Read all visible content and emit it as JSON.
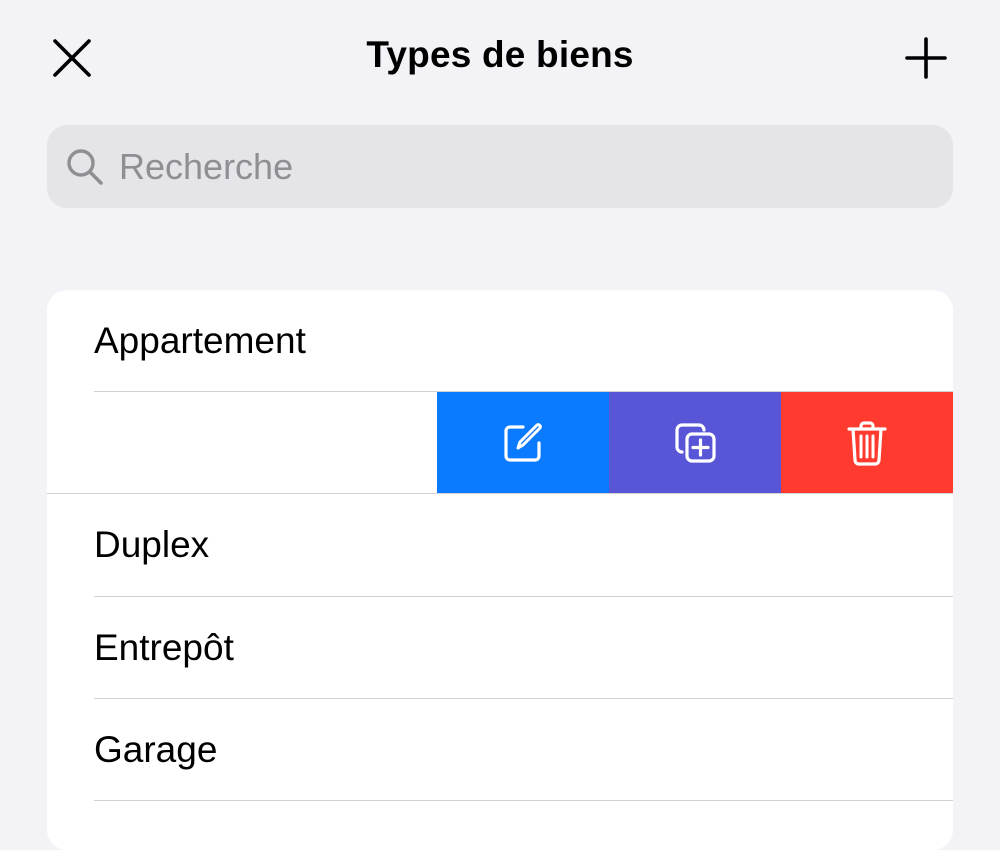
{
  "nav": {
    "title": "Types de biens",
    "close_icon": "xmark",
    "add_icon": "plus"
  },
  "search": {
    "placeholder": "Recherche",
    "value": "",
    "icon": "magnifyingglass"
  },
  "list": {
    "items": [
      {
        "label": "Appartement"
      },
      {
        "label": "Duplex"
      },
      {
        "label": "Entrepôt"
      },
      {
        "label": "Garage"
      }
    ]
  },
  "swipe_actions": [
    {
      "name": "edit",
      "icon": "square-and-pencil",
      "color": "#0a7aff"
    },
    {
      "name": "duplicate",
      "icon": "plus-square-on-square",
      "color": "#5856d6"
    },
    {
      "name": "delete",
      "icon": "trash",
      "color": "#ff3b30"
    }
  ],
  "colors": {
    "background": "#f2f2f7",
    "card": "#ffffff",
    "search_fill": "#e4e4e9",
    "placeholder": "#8e8e93",
    "separator": "#d1d1d6"
  }
}
